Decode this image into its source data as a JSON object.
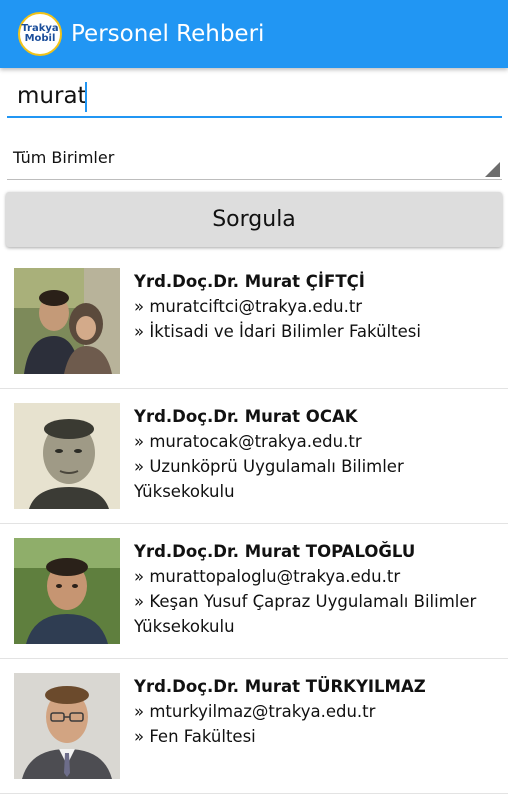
{
  "app": {
    "logo_line1": "Trakya",
    "logo_line2": "Mobil",
    "title": "Personel Rehberi"
  },
  "search": {
    "value": "murat"
  },
  "unit_select": {
    "selected": "Tüm Birimler"
  },
  "query_button": {
    "label": "Sorgula"
  },
  "results": [
    {
      "name": "Yrd.Doç.Dr. Murat ÇİFTÇİ",
      "email": "» muratciftci@trakya.edu.tr",
      "unit": "» İktisadi ve İdari Bilimler Fakültesi"
    },
    {
      "name": "Yrd.Doç.Dr. Murat OCAK",
      "email": "» muratocak@trakya.edu.tr",
      "unit": "» Uzunköprü Uygulamalı Bilimler Yüksekokulu"
    },
    {
      "name": "Yrd.Doç.Dr. Murat TOPALOĞLU",
      "email": "» murattopaloglu@trakya.edu.tr",
      "unit": "» Keşan Yusuf Çapraz Uygulamalı Bilimler Yüksekokulu"
    },
    {
      "name": "Yrd.Doç.Dr. Murat TÜRKYILMAZ",
      "email": "» mturkyilmaz@trakya.edu.tr",
      "unit": "» Fen Fakültesi"
    }
  ]
}
